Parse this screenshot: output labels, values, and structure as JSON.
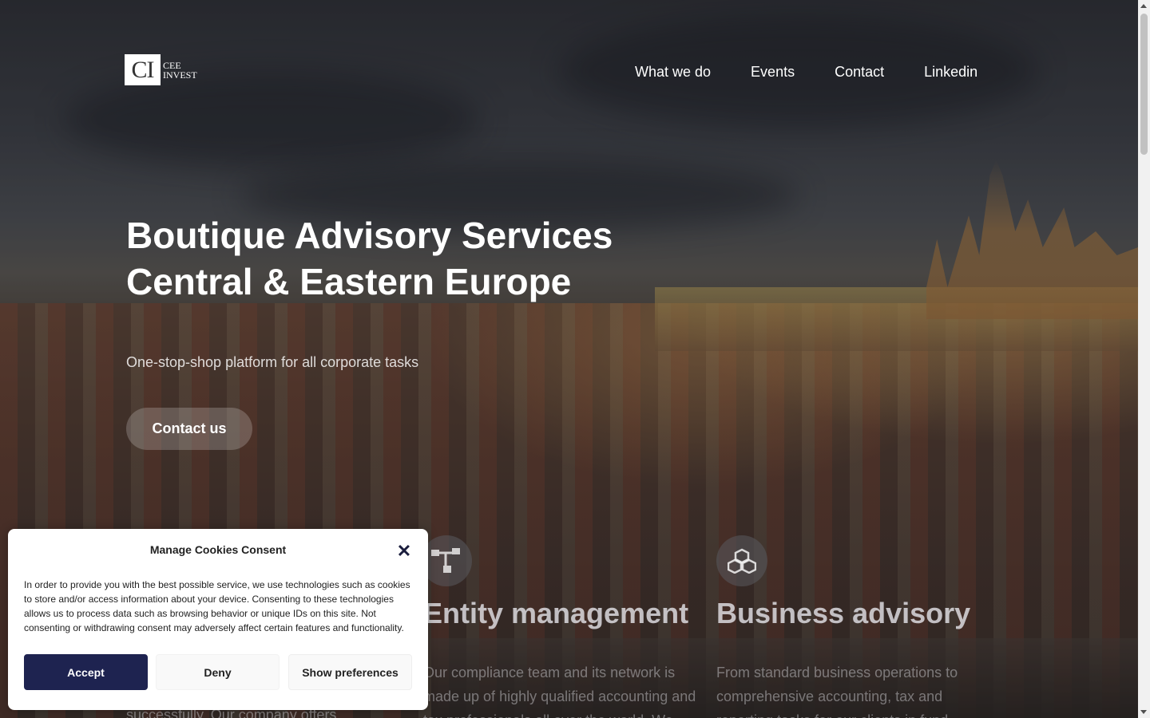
{
  "header": {
    "logo": {
      "mark": "CI",
      "line1": "CEE",
      "line2": "INVEST"
    },
    "nav": [
      {
        "label": "What we do"
      },
      {
        "label": "Events"
      },
      {
        "label": "Contact"
      },
      {
        "label": "Linkedin"
      }
    ]
  },
  "hero": {
    "title_line1": "Boutique Advisory Services",
    "title_line2": "Central & Eastern Europe",
    "subtitle": "One-stop-shop platform for all corporate tasks",
    "cta_label": "Contact us"
  },
  "services": [
    {
      "icon": "org-chart-icon",
      "title": "Entity management",
      "text_line1": "Our compliance team and its network is",
      "text_line2": "made up of highly qualified accounting and",
      "text_line3": "tax professionals all over the world. We"
    },
    {
      "icon": "cubes-icon",
      "title": "Business advisory",
      "text_line1": "From standard business operations to",
      "text_line2": "comprehensive accounting, tax and",
      "text_line3": "reporting tasks for our clients in fund"
    }
  ],
  "hidden_text": {
    "partial": "successfully. Our company offers"
  },
  "cookie": {
    "title": "Manage Cookies Consent",
    "close_glyph": "✕",
    "body": "In order to provide you with the best possible service, we use technologies such as cookies to store and/or access information about your device. Consenting to these technologies allows us to process data such as browsing behavior or unique IDs on this site. Not consenting or withdrawing consent may adversely affect certain features and functionality.",
    "accept_label": "Accept",
    "deny_label": "Deny",
    "prefs_label": "Show preferences"
  },
  "colors": {
    "accent": "#1e2350",
    "text_light": "#ffffff"
  }
}
